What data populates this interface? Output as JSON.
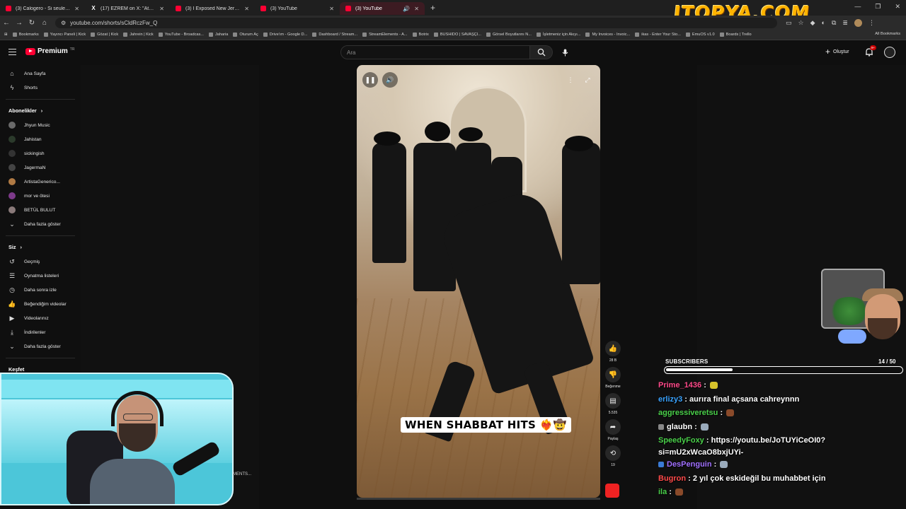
{
  "browser": {
    "tabs": [
      {
        "title": "(3) Calogero - Si seulement je p",
        "icon": "youtube-icon",
        "active": false
      },
      {
        "title": "(17) EZREM on X: \"Ataberk Doğ",
        "icon": "x-icon",
        "active": false
      },
      {
        "title": "(3) I Exposed New Jersey's Jew",
        "icon": "youtube-icon",
        "active": false
      },
      {
        "title": "(3) YouTube",
        "icon": "youtube-icon",
        "active": false
      },
      {
        "title": "(3) YouTube",
        "icon": "youtube-icon",
        "active": true
      }
    ],
    "url": "youtube.com/shorts/sCldRczFw_Q",
    "bookmarks": [
      "Bookmarks",
      "Yayıncı Paneli | Kick",
      "Gözat | Kick",
      "Jahrein | Kick",
      "YouTube - Broadcas...",
      "Jaharia",
      "Oturum Aç",
      "Drive'ım - Google D...",
      "Dashboard / Stream...",
      "StreamElements - A...",
      "Botrix",
      "BUSHIDO | SAVAŞÇI...",
      "Görsel Boyutlarını N...",
      "İşletmeniz için Akıyı...",
      "My Invoices - Invoic...",
      "ikas - Enter Your Sto...",
      "EmuOS v1.0",
      "Boards | Trello"
    ],
    "all_bookmarks": "All Bookmarks"
  },
  "watermark": "ITOPYA.COM",
  "youtube": {
    "logo": "Premium",
    "logo_tm": "TR",
    "search_placeholder": "Ara",
    "create_label": "Oluştur",
    "notif_count": "9+"
  },
  "sidebar": {
    "home": "Ana Sayfa",
    "shorts": "Shorts",
    "subs_header": "Abonelikler",
    "channels": [
      {
        "name": "Jhyun Music",
        "color": "#6a6a6a"
      },
      {
        "name": "Jahistan",
        "color": "#2b3a2b"
      },
      {
        "name": "sickingish",
        "color": "#333333"
      },
      {
        "name": "JagermaN",
        "color": "#444444"
      },
      {
        "name": "ArtistaGenerico...",
        "color": "#b07a44"
      },
      {
        "name": "mor ve ötesi",
        "color": "#7d3a8a"
      },
      {
        "name": "BETÜL BULUT",
        "color": "#8a7a7a"
      }
    ],
    "show_more_1": "Daha fazla göster",
    "you_header": "Siz",
    "you_items": [
      "Geçmiş",
      "Oynatma listeleri",
      "Daha sonra izle",
      "Beğendiğim videolar",
      "Videolarınız",
      "İndirilenler"
    ],
    "show_more_2": "Daha fazla göster",
    "explore_header": "Keşfet"
  },
  "video": {
    "caption": "WHEN SHABBAT HITS",
    "caption_emoji": "❤‍🔥🤠",
    "likes": "28 B",
    "dislike_label": "Beğenme",
    "comments": "5.535",
    "share_label": "Paylaş",
    "remix_count": "19"
  },
  "overlay": {
    "ments_text": "MENTS...",
    "subscribers_title": "SUBSCRIBERS",
    "subscribers_count": "14 / 50",
    "subscribers_progress": 0.28
  },
  "chat": [
    {
      "user": "Prime_1436",
      "color": "#ff4a8a",
      "text": "",
      "badge": "",
      "emote": "#d6c22b"
    },
    {
      "user": "erlizy3",
      "color": "#3aa3ff",
      "text": "aurıra final açsana cahreynnn",
      "badge": "",
      "emote": ""
    },
    {
      "user": "aggressiveretsu",
      "color": "#4ad04a",
      "text": "",
      "badge": "",
      "emote": "#8a4a2a"
    },
    {
      "user": "glaubn",
      "color": "#ffffff",
      "text": "",
      "badge": "#888888",
      "emote": "#9ab"
    },
    {
      "user": "SpeedyFoxy",
      "color": "#4ad04a",
      "text": "https://youtu.be/JoTUYiCeOI0?si=mU2xWcaO8bxjUYi-",
      "badge": "",
      "emote": ""
    },
    {
      "user": "DesPenguin",
      "color": "#a070ff",
      "text": "",
      "badge": "#3a7bd5",
      "emote": "#9ab"
    },
    {
      "user": "Bugron",
      "color": "#ff4a4a",
      "text": "2 yıl çok eskideğil bu muhabbet için",
      "badge": "",
      "emote": ""
    },
    {
      "user": "ila",
      "color": "#4ad04a",
      "text": "",
      "badge": "",
      "emote": "#8a4a2a"
    }
  ]
}
